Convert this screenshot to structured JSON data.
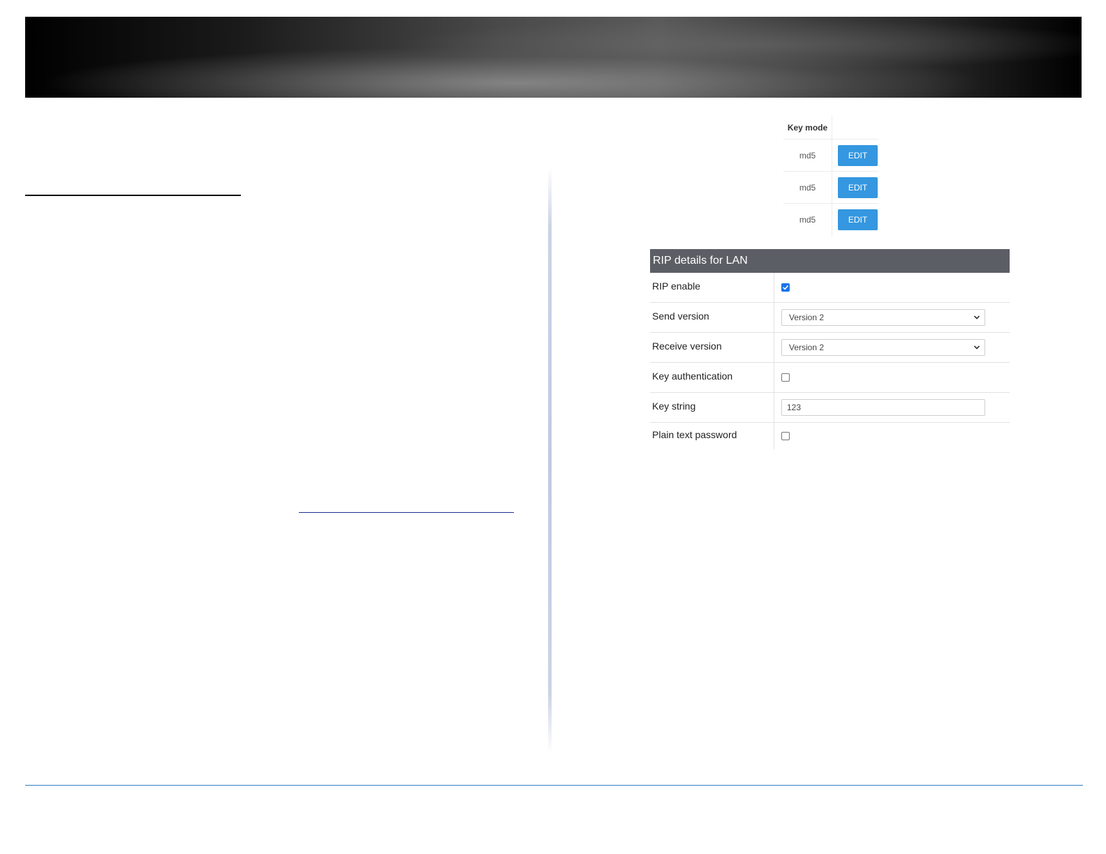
{
  "keymode_table": {
    "header": "Key mode",
    "rows": [
      {
        "mode": "md5",
        "action": "EDIT"
      },
      {
        "mode": "md5",
        "action": "EDIT"
      },
      {
        "mode": "md5",
        "action": "EDIT"
      }
    ]
  },
  "rip_panel": {
    "title": "RIP details for LAN",
    "rip_enable": {
      "label": "RIP enable",
      "checked": true
    },
    "send_version": {
      "label": "Send version",
      "value": "Version 2"
    },
    "receive_version": {
      "label": "Receive version",
      "value": "Version 2"
    },
    "key_authentication": {
      "label": "Key authentication",
      "checked": false
    },
    "key_string": {
      "label": "Key string",
      "value": "123"
    },
    "plain_text_password": {
      "label": "Plain text password",
      "checked": false
    }
  },
  "colors": {
    "edit_button": "#3497e0",
    "panel_header": "#5b5f65",
    "checkbox_checked": "#1a73e8",
    "footer_line": "#2f7fc1"
  },
  "icons": {
    "dropdown": "chevron-down-icon",
    "checkmark": "check-icon"
  }
}
